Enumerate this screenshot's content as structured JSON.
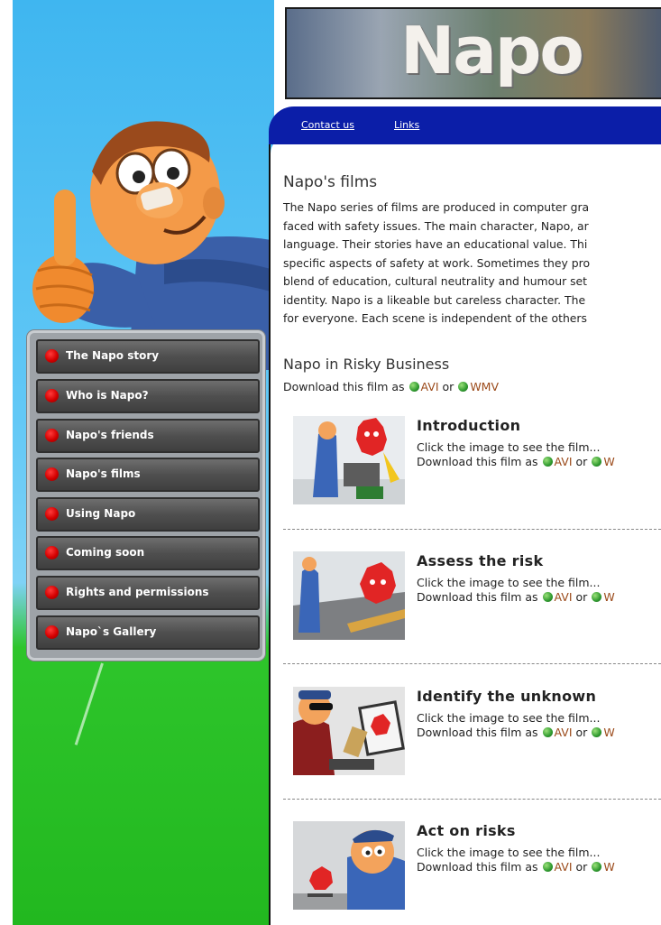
{
  "banner": {
    "title": "Napo"
  },
  "topnav": {
    "contact": "Contact us",
    "links": "Links"
  },
  "menu": {
    "items": [
      "The Napo story",
      "Who is Napo?",
      "Napo's friends",
      "Napo's films",
      "Using Napo",
      "Coming soon",
      "Rights and permissions",
      "Napo`s Gallery"
    ]
  },
  "content": {
    "heading": "Napo's films",
    "paragraph_lines": [
      "The Napo series of films are produced in computer gra",
      "faced with safety issues. The main character, Napo, ar",
      "language. Their stories have an educational value. Thi",
      "specific aspects of safety at work. Sometimes they pro",
      "blend of education, cultural neutrality and humour set",
      "identity. Napo is a likeable but careless character. The",
      "for everyone. Each scene is independent of the others"
    ],
    "series_title": "Napo in Risky Business",
    "download_prefix": "Download this film as",
    "avi": "AVI",
    "or": "or",
    "wmv": "WMV"
  },
  "films": [
    {
      "title": "Introduction",
      "hint": "Click the image to see the film...",
      "download": "Download this film as",
      "avi": "AVI",
      "or": "or",
      "wmv": "W"
    },
    {
      "title": "Assess the risk",
      "hint": "Click the image to see the film...",
      "download": "Download this film as",
      "avi": "AVI",
      "or": "or",
      "wmv": "W"
    },
    {
      "title": "Identify the unknown",
      "hint": "Click the image to see the film...",
      "download": "Download this film as",
      "avi": "AVI",
      "or": "or",
      "wmv": "W"
    },
    {
      "title": "Act on risks",
      "hint": "Click the image to see the film...",
      "download": "Download this film as",
      "avi": "AVI",
      "or": "or",
      "wmv": "W"
    }
  ],
  "colors": {
    "nav_bar": "#0b1ea8",
    "link": "#9b4a1a",
    "menu_dot": "#d30000",
    "grass": "#22b81f",
    "sky": "#3fb6f0"
  }
}
